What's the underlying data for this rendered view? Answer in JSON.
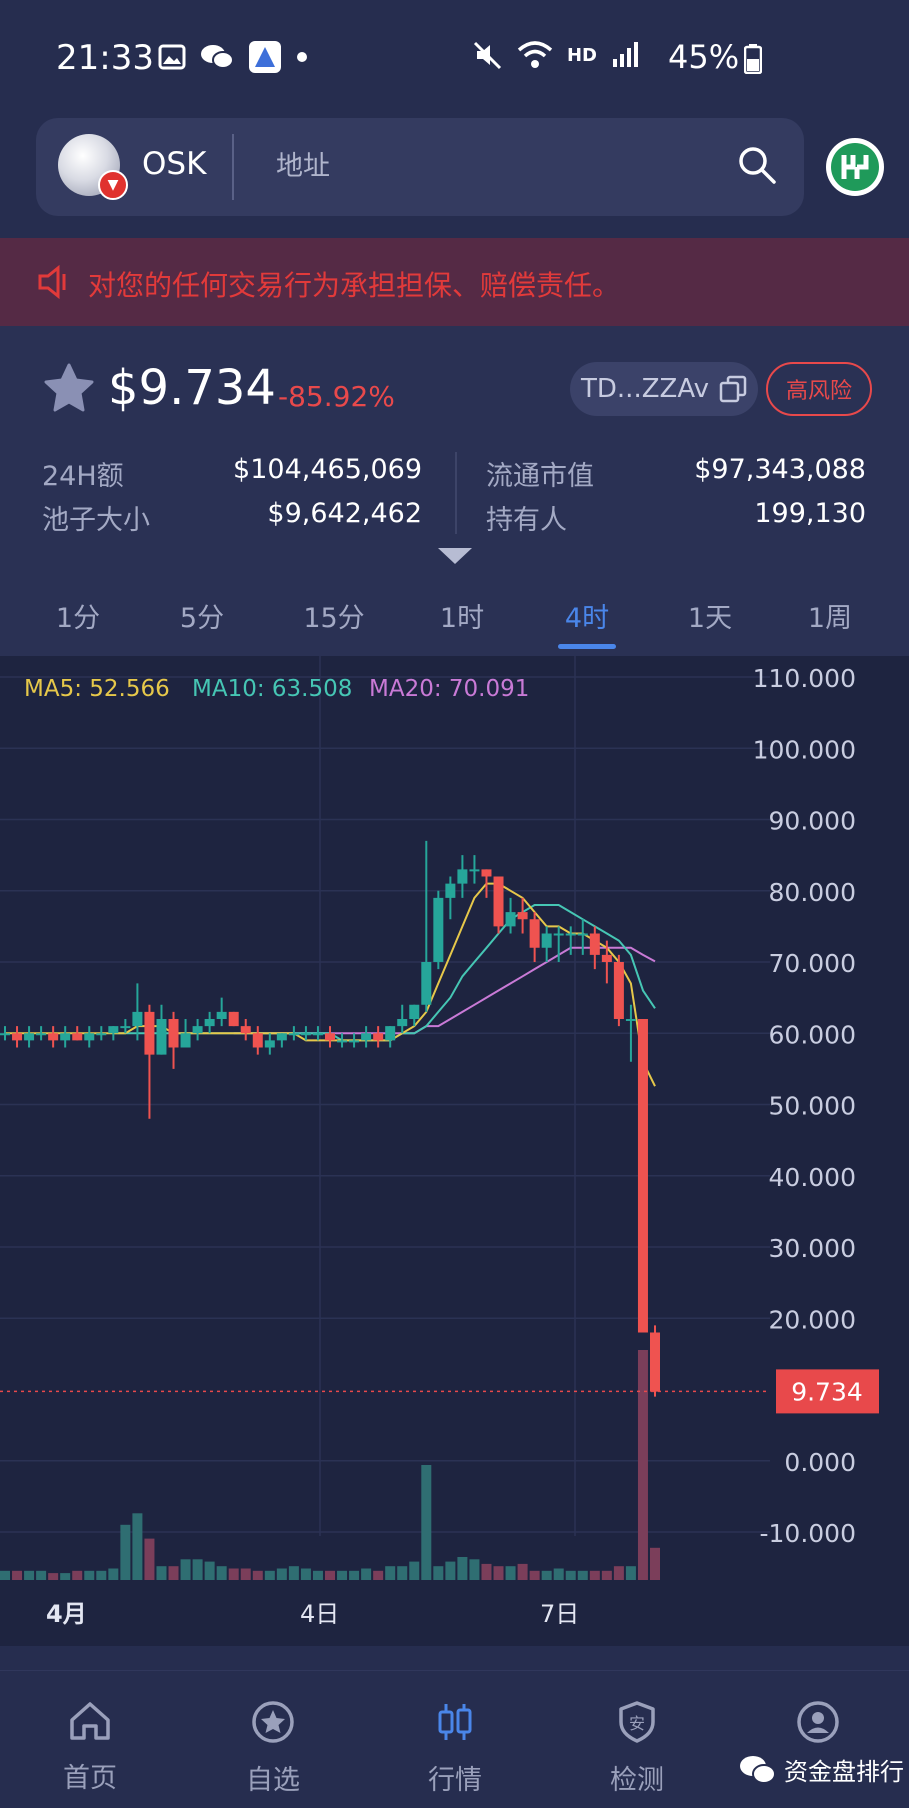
{
  "status_bar": {
    "time": "21:33",
    "battery": "45%",
    "network": "HD"
  },
  "search": {
    "token_symbol": "OSK",
    "placeholder": "地址"
  },
  "warning": {
    "text": "对您的任何交易行为承担担保、赔偿责任。"
  },
  "price": {
    "value": "$9.734",
    "change": "-85.92%",
    "address": "TD...ZZAv",
    "risk_label": "高风险"
  },
  "stats": {
    "volume_24h_label": "24H额",
    "volume_24h_value": "$104,465,069",
    "pool_label": "池子大小",
    "pool_value": "$9,642,462",
    "mcap_label": "流通市值",
    "mcap_value": "$97,343,088",
    "holders_label": "持有人",
    "holders_value": "199,130"
  },
  "timeframes": [
    "1分",
    "5分",
    "15分",
    "1时",
    "4时",
    "1天",
    "1周"
  ],
  "active_timeframe": "4时",
  "ma": {
    "ma5": "MA5: 52.566",
    "ma10": "MA10: 63.508",
    "ma20": "MA20: 70.091"
  },
  "colors": {
    "up": "#26a69a",
    "down": "#ef5350",
    "ma5": "#e6c84a",
    "ma10": "#46c6b4",
    "ma20": "#c97ad6",
    "accent": "#4a86ea"
  },
  "chart_data": {
    "type": "candlestick",
    "y_ticks": [
      "110.000",
      "100.000",
      "90.000",
      "80.000",
      "70.000",
      "60.000",
      "50.000",
      "40.000",
      "30.000",
      "20.000",
      "0.000",
      "-10.000"
    ],
    "ylim": [
      -10,
      110
    ],
    "x_labels": [
      "4月",
      "4日",
      "7日"
    ],
    "current_price_label": "9.734",
    "candles": [
      [
        60,
        61,
        59,
        60
      ],
      [
        60,
        61,
        58,
        59
      ],
      [
        59,
        61,
        58,
        60
      ],
      [
        60,
        61,
        59,
        60
      ],
      [
        60,
        61,
        58,
        59
      ],
      [
        59,
        61,
        58,
        60
      ],
      [
        60,
        61,
        59,
        59
      ],
      [
        59,
        61,
        58,
        60
      ],
      [
        60,
        61,
        59,
        60
      ],
      [
        60,
        61,
        59,
        61
      ],
      [
        61,
        62,
        60,
        61
      ],
      [
        61,
        67,
        59,
        63
      ],
      [
        63,
        64,
        48,
        57
      ],
      [
        57,
        64,
        57,
        62
      ],
      [
        62,
        63,
        55,
        58
      ],
      [
        58,
        62,
        58,
        60
      ],
      [
        60,
        62,
        59,
        61
      ],
      [
        61,
        63,
        60,
        62
      ],
      [
        62,
        65,
        61,
        63
      ],
      [
        63,
        63,
        61,
        61
      ],
      [
        61,
        62,
        59,
        60
      ],
      [
        60,
        61,
        57,
        58
      ],
      [
        58,
        60,
        57,
        59
      ],
      [
        59,
        60,
        58,
        60
      ],
      [
        60,
        61,
        59,
        60
      ],
      [
        60,
        61,
        59,
        60
      ],
      [
        60,
        61,
        59,
        60
      ],
      [
        60,
        61,
        58,
        59
      ],
      [
        59,
        60,
        58,
        59
      ],
      [
        59,
        60,
        58,
        59
      ],
      [
        59,
        61,
        58,
        60
      ],
      [
        60,
        61,
        58,
        59
      ],
      [
        59,
        61,
        58,
        61
      ],
      [
        61,
        64,
        60,
        62
      ],
      [
        62,
        64,
        61,
        64
      ],
      [
        64,
        87,
        63,
        70
      ],
      [
        70,
        80,
        69,
        79
      ],
      [
        79,
        82,
        76,
        81
      ],
      [
        81,
        85,
        79,
        83
      ],
      [
        83,
        85,
        81,
        83
      ],
      [
        83,
        83,
        79,
        82
      ],
      [
        82,
        82,
        74,
        75
      ],
      [
        75,
        79,
        74,
        77
      ],
      [
        77,
        79,
        74,
        76
      ],
      [
        76,
        77,
        70,
        72
      ],
      [
        72,
        75,
        70,
        74
      ],
      [
        74,
        75,
        70,
        74
      ],
      [
        74,
        75,
        71,
        74
      ],
      [
        74,
        76,
        71,
        74
      ],
      [
        74,
        75,
        69,
        71
      ],
      [
        71,
        73,
        67,
        70
      ],
      [
        70,
        71,
        61,
        62
      ],
      [
        62,
        64,
        56,
        62
      ],
      [
        62,
        62,
        18,
        18
      ],
      [
        18,
        19,
        9,
        9.7
      ]
    ],
    "ma5": [
      60,
      60,
      60,
      60,
      60,
      60,
      60,
      60,
      60,
      60,
      60,
      61,
      61,
      61,
      60,
      60,
      60,
      60,
      60,
      60,
      60,
      60,
      60,
      60,
      60,
      59,
      59,
      59,
      59,
      59,
      59,
      59,
      59,
      60,
      61,
      63,
      67,
      71,
      75,
      79,
      81,
      81,
      80,
      79,
      77,
      75,
      75,
      74,
      74,
      73,
      72,
      70,
      67,
      56,
      52.566
    ],
    "ma10": [
      null,
      null,
      null,
      null,
      null,
      null,
      null,
      null,
      null,
      60,
      60,
      60,
      60,
      60,
      60,
      60,
      60,
      60,
      60,
      60,
      60,
      60,
      60,
      60,
      60,
      60,
      60,
      60,
      59,
      59,
      59,
      59,
      59,
      60,
      60,
      61,
      63,
      65,
      68,
      70,
      72,
      74,
      76,
      77,
      78,
      78,
      78,
      77,
      76,
      75,
      74,
      73,
      71,
      66,
      63.508
    ],
    "ma20": [
      null,
      null,
      null,
      null,
      null,
      null,
      null,
      null,
      null,
      null,
      null,
      null,
      null,
      null,
      null,
      null,
      null,
      null,
      null,
      60,
      60,
      60,
      60,
      60,
      60,
      60,
      60,
      60,
      60,
      60,
      60,
      60,
      60,
      60,
      60,
      61,
      61,
      62,
      63,
      64,
      65,
      66,
      67,
      68,
      69,
      70,
      71,
      72,
      72,
      72,
      72,
      72,
      72,
      71,
      70.091
    ],
    "volume": [
      4,
      4,
      4,
      4,
      3,
      3,
      4,
      4,
      4,
      5,
      24,
      29,
      18,
      6,
      6,
      9,
      9,
      8,
      6,
      5,
      5,
      4,
      4,
      5,
      6,
      5,
      4,
      4,
      4,
      4,
      5,
      4,
      6,
      6,
      8,
      50,
      6,
      8,
      10,
      9,
      7,
      6,
      6,
      7,
      4,
      4,
      5,
      4,
      4,
      4,
      4,
      6,
      6,
      100,
      14
    ]
  },
  "nav": {
    "home": "首页",
    "watchlist": "自选",
    "market": "行情",
    "detect": "检测",
    "profile": "我的"
  },
  "watermark": "资金盘排行"
}
